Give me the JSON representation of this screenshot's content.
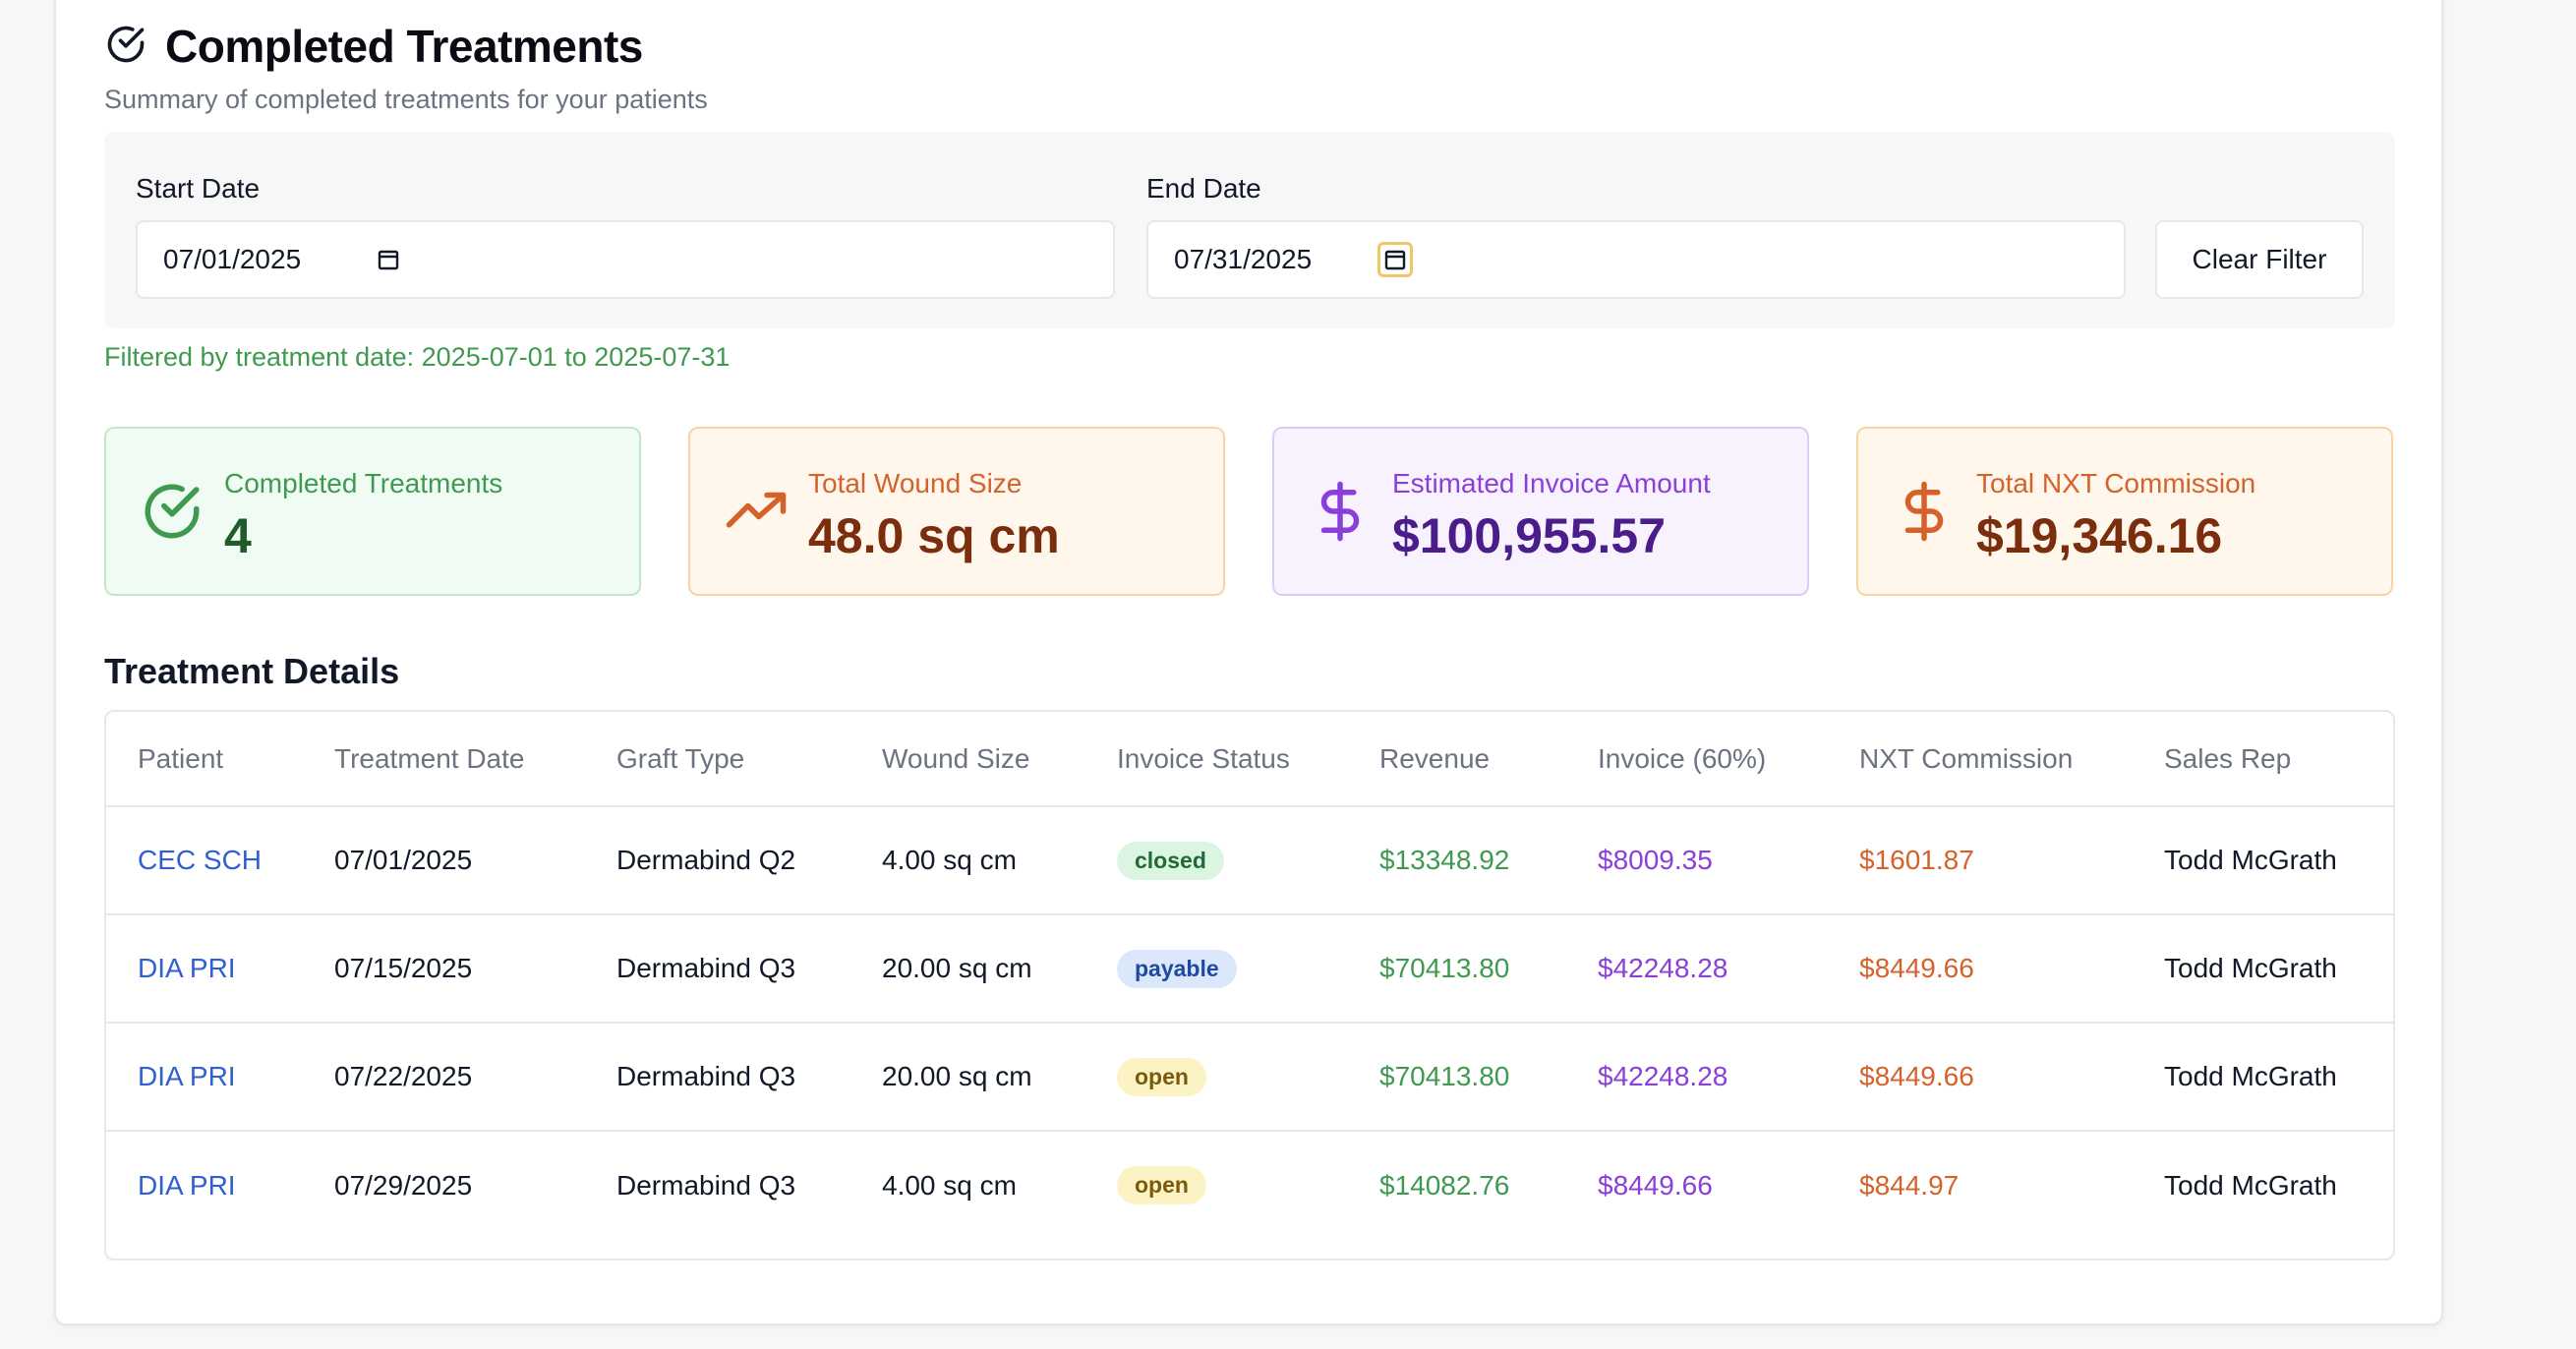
{
  "header": {
    "title": "Completed Treatments",
    "subtitle": "Summary of completed treatments for your patients"
  },
  "filters": {
    "start_label": "Start Date",
    "start_value": "07/01/2025",
    "end_label": "End Date",
    "end_value": "07/31/2025",
    "clear_label": "Clear Filter",
    "note": "Filtered by treatment date: 2025-07-01 to 2025-07-31"
  },
  "stats": [
    {
      "label": "Completed Treatments",
      "value": "4",
      "icon": "check-circle-icon"
    },
    {
      "label": "Total Wound Size",
      "value": "48.0 sq cm",
      "icon": "trending-up-icon"
    },
    {
      "label": "Estimated Invoice Amount",
      "value": "$100,955.57",
      "icon": "dollar-icon"
    },
    {
      "label": "Total NXT Commission",
      "value": "$19,346.16",
      "icon": "dollar-icon"
    }
  ],
  "details": {
    "title": "Treatment Details",
    "columns": [
      "Patient",
      "Treatment Date",
      "Graft Type",
      "Wound Size",
      "Invoice Status",
      "Revenue",
      "Invoice (60%)",
      "NXT Commission",
      "Sales Rep"
    ],
    "rows": [
      {
        "patient": "CEC SCH",
        "date": "07/01/2025",
        "graft": "Dermabind Q2",
        "wound": "4.00 sq cm",
        "status": "closed",
        "revenue": "$13348.92",
        "invoice": "$8009.35",
        "commission": "$1601.87",
        "rep": "Todd McGrath"
      },
      {
        "patient": "DIA PRI",
        "date": "07/15/2025",
        "graft": "Dermabind Q3",
        "wound": "20.00 sq cm",
        "status": "payable",
        "revenue": "$70413.80",
        "invoice": "$42248.28",
        "commission": "$8449.66",
        "rep": "Todd McGrath"
      },
      {
        "patient": "DIA PRI",
        "date": "07/22/2025",
        "graft": "Dermabind Q3",
        "wound": "20.00 sq cm",
        "status": "open",
        "revenue": "$70413.80",
        "invoice": "$42248.28",
        "commission": "$8449.66",
        "rep": "Todd McGrath"
      },
      {
        "patient": "DIA PRI",
        "date": "07/29/2025",
        "graft": "Dermabind Q3",
        "wound": "4.00 sq cm",
        "status": "open",
        "revenue": "$14082.76",
        "invoice": "$8449.66",
        "commission": "$844.97",
        "rep": "Todd McGrath"
      }
    ]
  },
  "colors": {
    "green": "#3f9a50",
    "orange": "#d5622a",
    "purple": "#8b3fd9",
    "link_blue": "#2f5fd0"
  }
}
